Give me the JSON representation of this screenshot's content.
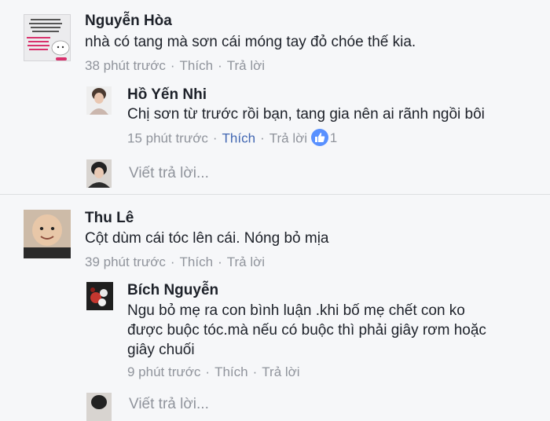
{
  "comments": [
    {
      "author": "Nguyễn Hòa",
      "avatar_text": "NẾU SỰ NGHIỆP CÓ THỂ LÀ DO TRIỆU MÁY NẮN NHỮNG SẼ MẤT GIA ĐÌNH THÌ CHẮC CHẮN · LÀ SỰ THẤT BẠI CỦA MỘT THẰNG ĐÀN ÔNG",
      "text": "nhà có tang mà sơn cái móng tay đỏ chóe thế kia.",
      "time": "38 phút trước",
      "like_label": "Thích",
      "reply_label": "Trả lời",
      "replies": [
        {
          "author": "Hồ Yến Nhi",
          "text": "Chị sơn từ trước rồi bạn, tang gia nên ai rãnh ngồi bôi",
          "time": "15 phút trước",
          "like_label": "Thích",
          "reply_label": "Trả lời",
          "reaction_count": "1"
        }
      ],
      "reply_placeholder": "Viết trả lời..."
    },
    {
      "author": "Thu Lê",
      "text": "Cột dùm cái tóc lên cái. Nóng bỏ mịa",
      "time": "39 phút trước",
      "like_label": "Thích",
      "reply_label": "Trả lời",
      "replies": [
        {
          "author": "Bích Nguyễn",
          "text_lines": [
            "Ngu bỏ mẹ ra con bình luận .khi bố mẹ chết con ko",
            "được buộc tóc.mà nếu có buộc thì phải giây rơm hoặc",
            "giây chuối"
          ],
          "time": "9 phút trước",
          "like_label": "Thích",
          "reply_label": "Trả lời"
        }
      ],
      "reply_placeholder": "Viết trả lời..."
    }
  ],
  "colors": {
    "background": "#f6f7f9",
    "name": "#1d2129",
    "meta": "#90949c",
    "link_active": "#4267b2",
    "like_badge": "#5890ff"
  }
}
